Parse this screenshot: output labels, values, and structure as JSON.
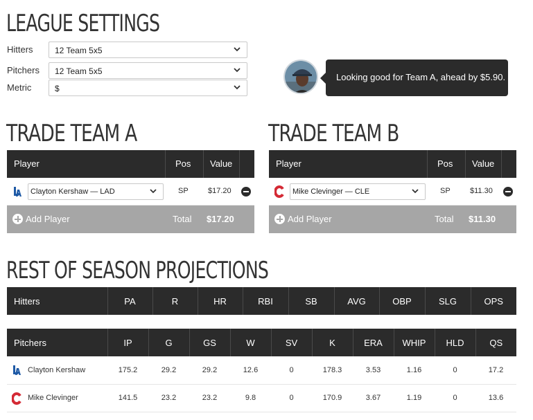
{
  "page": {
    "title": "LEAGUE SETTINGS"
  },
  "settings": {
    "hitters": {
      "label": "Hitters",
      "value": "12 Team 5x5"
    },
    "pitchers": {
      "label": "Pitchers",
      "value": "12 Team 5x5"
    },
    "metric": {
      "label": "Metric",
      "value": "$"
    }
  },
  "tooltip": {
    "text": "Looking good for Team A, ahead by $5.90."
  },
  "team_a": {
    "title": "TRADE TEAM A",
    "columns": [
      "Player",
      "Pos",
      "Value"
    ],
    "players": [
      {
        "logo": "dodgers-logo",
        "name": "Clayton Kershaw — LAD",
        "pos": "SP",
        "value": "$17.20"
      }
    ],
    "add_label": "Add Player",
    "total_label": "Total",
    "total_value": "$17.20"
  },
  "team_b": {
    "title": "TRADE TEAM B",
    "columns": [
      "Player",
      "Pos",
      "Value"
    ],
    "players": [
      {
        "logo": "indians-logo",
        "name": "Mike Clevinger — CLE",
        "pos": "SP",
        "value": "$11.30"
      }
    ],
    "add_label": "Add Player",
    "total_label": "Total",
    "total_value": "$11.30"
  },
  "projections": {
    "title": "REST OF SEASON PROJECTIONS",
    "hitters": {
      "columns": [
        "Hitters",
        "PA",
        "R",
        "HR",
        "RBI",
        "SB",
        "AVG",
        "OBP",
        "SLG",
        "OPS"
      ]
    },
    "pitchers": {
      "columns": [
        "Pitchers",
        "IP",
        "G",
        "GS",
        "W",
        "SV",
        "K",
        "ERA",
        "WHIP",
        "HLD",
        "QS"
      ],
      "rows": [
        {
          "logo": "dodgers-logo",
          "name": "Clayton Kershaw",
          "cells": [
            "175.2",
            "29.2",
            "29.2",
            "12.6",
            "0",
            "178.3",
            "3.53",
            "1.16",
            "0",
            "17.2"
          ]
        },
        {
          "logo": "indians-logo",
          "name": "Mike Clevinger",
          "cells": [
            "141.5",
            "23.2",
            "23.2",
            "9.8",
            "0",
            "170.9",
            "3.67",
            "1.19",
            "0",
            "13.6"
          ]
        }
      ]
    }
  },
  "colors": {
    "header_bg": "#2b2b2b",
    "footer_bg": "#a6a6a6",
    "dodgers_blue": "#1f5aa6",
    "indians_red": "#d42a35"
  }
}
